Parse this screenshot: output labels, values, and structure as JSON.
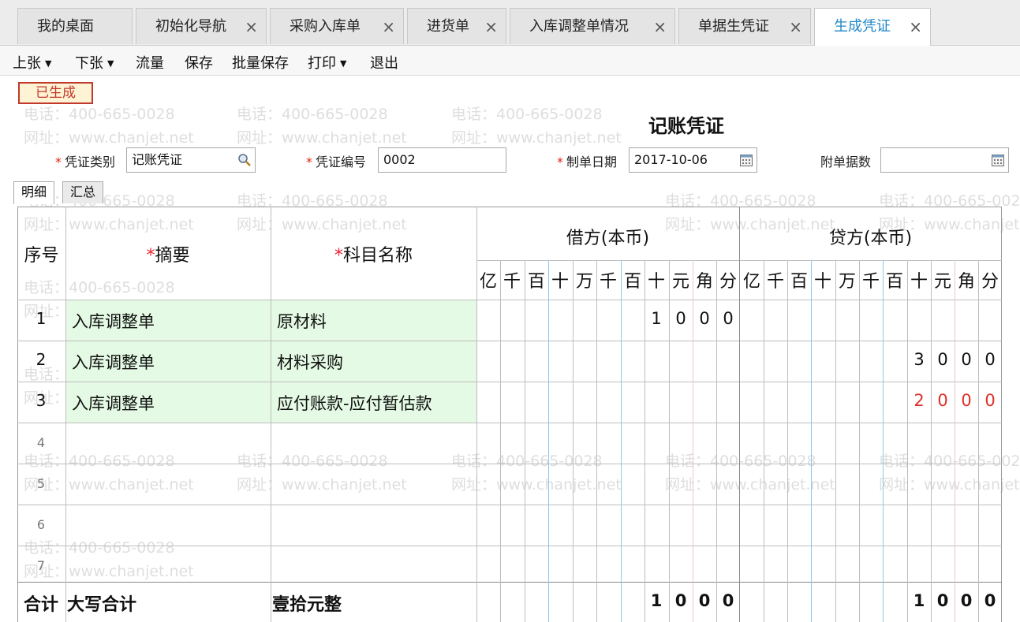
{
  "tabs": [
    {
      "label": "我的桌面",
      "closable": false,
      "active": false
    },
    {
      "label": "初始化导航",
      "closable": true,
      "active": false
    },
    {
      "label": "采购入库单",
      "closable": true,
      "active": false
    },
    {
      "label": "进货单",
      "closable": true,
      "active": false
    },
    {
      "label": "入库调整单情况",
      "closable": true,
      "active": false
    },
    {
      "label": "单据生凭证",
      "closable": true,
      "active": false
    },
    {
      "label": "生成凭证",
      "closable": true,
      "active": true
    }
  ],
  "close_glyph": "×",
  "toolbar": [
    {
      "label": "上张",
      "has_menu": true
    },
    {
      "label": "下张",
      "has_menu": true
    },
    {
      "label": "流量",
      "has_menu": false
    },
    {
      "label": "保存",
      "has_menu": false
    },
    {
      "label": "批量保存",
      "has_menu": false
    },
    {
      "label": "打印",
      "has_menu": true
    },
    {
      "label": "退出",
      "has_menu": false
    }
  ],
  "status_badge": "已生成",
  "voucher_title": "记账凭证",
  "form": {
    "voucher_type_label": "凭证类别",
    "voucher_type_value": "记账凭证",
    "voucher_no_label": "凭证编号",
    "voucher_no_value": "0002",
    "date_label": "制单日期",
    "date_value": "2017-10-06",
    "attachments_label": "附单据数",
    "attachments_value": ""
  },
  "subtabs": [
    "明细",
    "汇总"
  ],
  "grid": {
    "col_seq": "序号",
    "col_summary": "摘要",
    "col_account": "科目名称",
    "debit_header": "借方(本币)",
    "credit_header": "贷方(本币)",
    "required_mark": "*",
    "digit_units": [
      "亿",
      "千",
      "百",
      "十",
      "万",
      "千",
      "百",
      "十",
      "元",
      "角",
      "分"
    ],
    "rows": [
      {
        "no": "1",
        "summary": "入库调整单",
        "account": "原材料",
        "debit": "1000",
        "credit": "",
        "credit_red": false
      },
      {
        "no": "2",
        "summary": "入库调整单",
        "account": "材料采购",
        "debit": "",
        "credit": "3000",
        "credit_red": false
      },
      {
        "no": "3",
        "summary": "入库调整单",
        "account": "应付账款-应付暂估款",
        "debit": "",
        "credit": "2000",
        "credit_red": true
      },
      {
        "no": "4",
        "summary": "",
        "account": "",
        "debit": "",
        "credit": "",
        "credit_red": false
      },
      {
        "no": "5",
        "summary": "",
        "account": "",
        "debit": "",
        "credit": "",
        "credit_red": false
      },
      {
        "no": "6",
        "summary": "",
        "account": "",
        "debit": "",
        "credit": "",
        "credit_red": false
      },
      {
        "no": "7",
        "summary": "",
        "account": "",
        "debit": "",
        "credit": "",
        "credit_red": false
      }
    ],
    "total_label": "合计",
    "total_caps_label": "大写合计",
    "total_caps_value": "壹拾元整",
    "total_debit": "1000",
    "total_credit": "1000"
  },
  "watermark": {
    "phone": "电话：400-665-0028",
    "site": "网址：www.chanjet.net"
  },
  "colors": {
    "active_tab": "#1e88c8",
    "red_amount": "#e0302a",
    "status_border": "#c0392b",
    "green_cells": "#e4fae4"
  },
  "icons": {
    "voucher_type_lookup": "search-icon",
    "date_picker": "calendar-icon",
    "attachments_picker": "calendar-icon",
    "toolbar_menu": "caret-down-icon",
    "tab_close": "close-icon"
  }
}
